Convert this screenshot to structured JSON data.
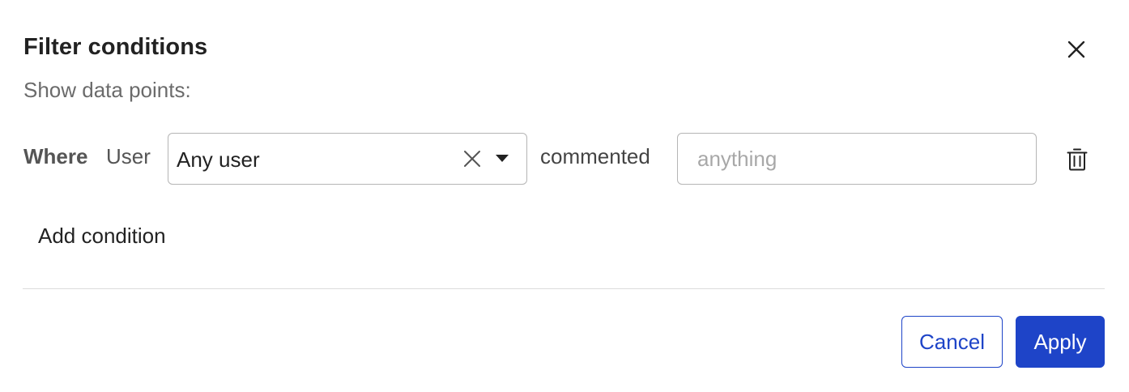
{
  "dialog": {
    "title": "Filter conditions",
    "subtitle": "Show data points:",
    "close_icon": "close-icon"
  },
  "condition": {
    "prefix": "Where",
    "field": "User",
    "select_value": "Any user",
    "clear_icon": "clear-icon",
    "dropdown_icon": "chevron-down-icon",
    "verb": "commented",
    "input_value": "",
    "input_placeholder": "anything",
    "delete_icon": "trash-icon"
  },
  "add_condition_label": "Add condition",
  "footer": {
    "cancel_label": "Cancel",
    "apply_label": "Apply"
  },
  "colors": {
    "primary": "#1e44c8",
    "border": "#b5b5b5",
    "divider": "#dcdcdc",
    "muted_text": "#6b6b6b",
    "placeholder": "#a8a8a8"
  }
}
